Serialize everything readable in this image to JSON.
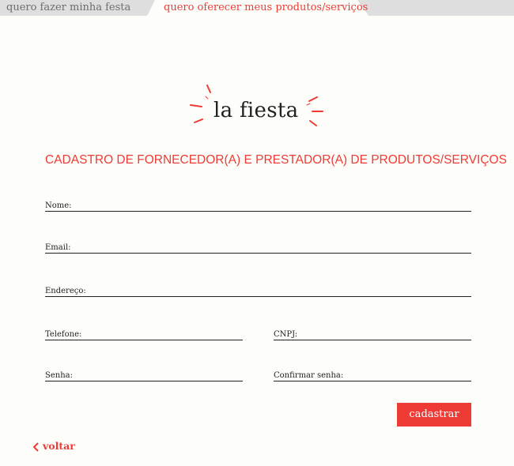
{
  "tabs": [
    {
      "label": "quero fazer minha festa",
      "active": false
    },
    {
      "label": "quero oferecer meus produtos/serviços",
      "active": true
    }
  ],
  "logo": {
    "text": "la fiesta"
  },
  "page_title": "CADASTRO DE FORNECEDOR(A) E PRESTADOR(A) DE PRODUTOS/SERVIÇOS",
  "form": {
    "name_label": "Nome:",
    "email_label": "Email:",
    "address_label": "Endereço:",
    "phone_label": "Telefone:",
    "cnpj_label": "CNPJ:",
    "password_label": "Senha:",
    "confirm_password_label": "Confirmar senha:",
    "submit_label": "cadastrar"
  },
  "back_link": {
    "label": "voltar",
    "icon": "chevron-left-icon"
  },
  "colors": {
    "accent": "#ee3b36",
    "tab_bg": "#dedede",
    "page_bg": "#fdfdf9",
    "text": "#222222"
  }
}
